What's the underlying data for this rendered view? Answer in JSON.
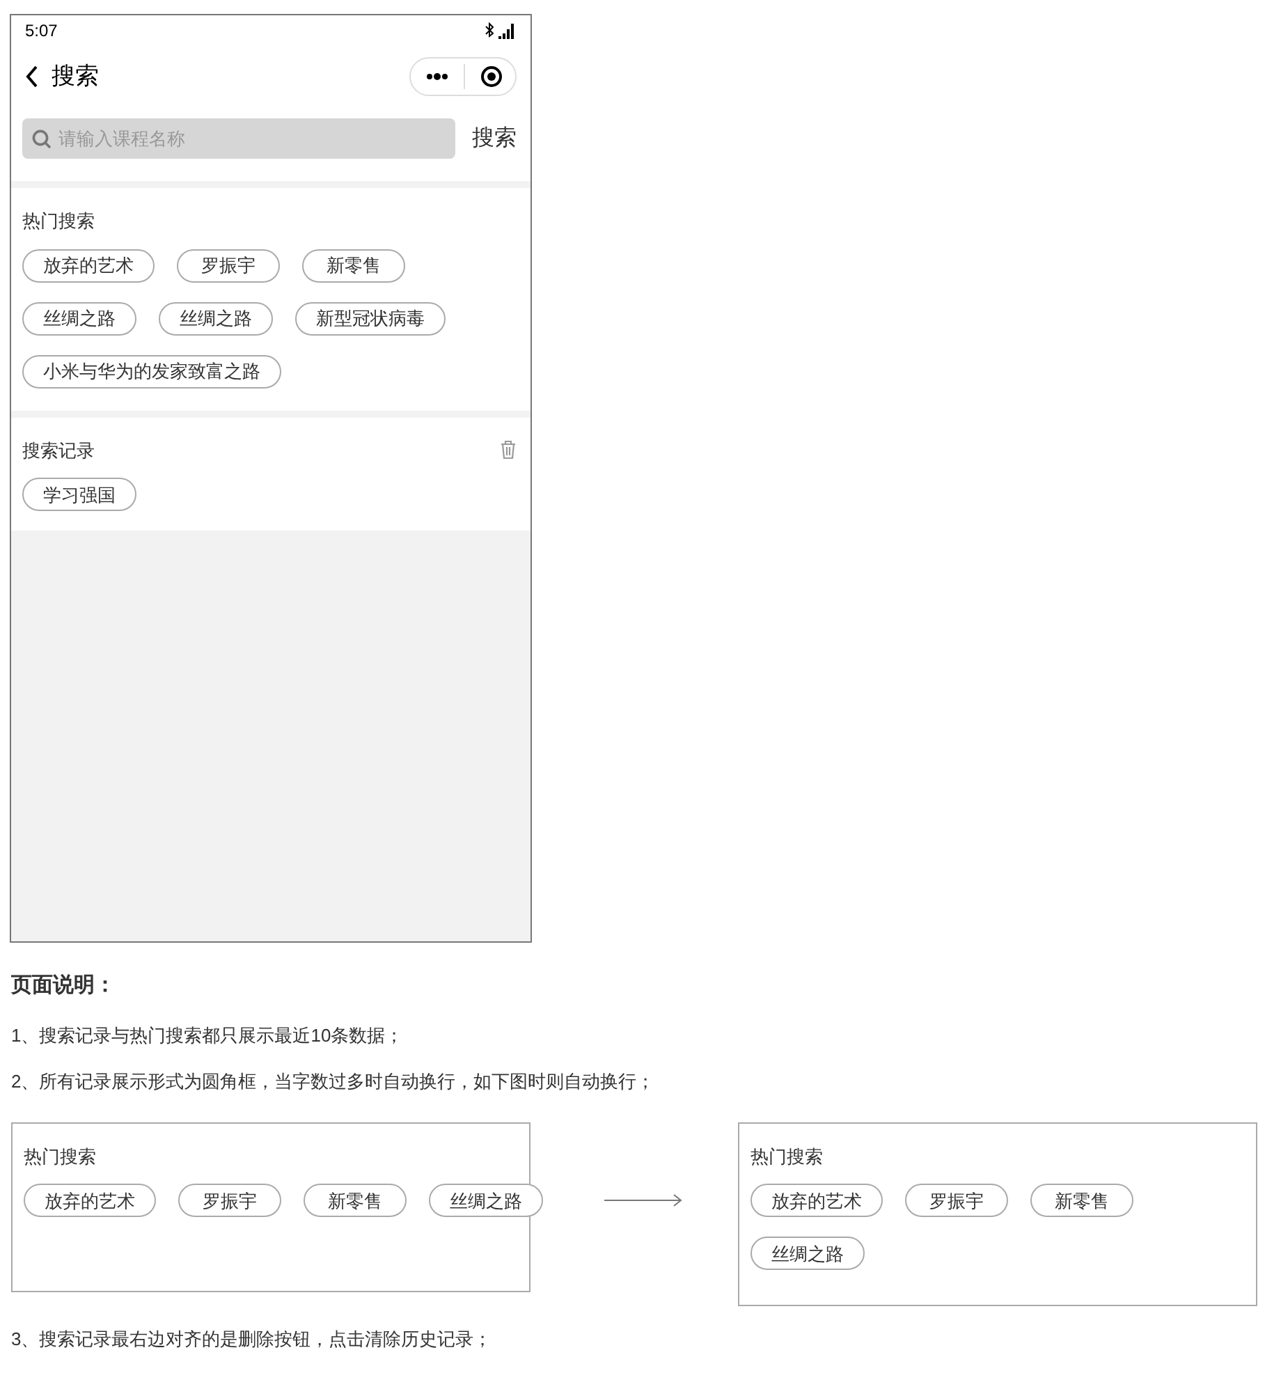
{
  "status_bar": {
    "time": "5:07"
  },
  "nav": {
    "title": "搜索"
  },
  "search": {
    "placeholder": "请输入课程名称",
    "button": "搜索"
  },
  "hot_search": {
    "title": "热门搜索",
    "tags": [
      "放弃的艺术",
      "罗振宇",
      "新零售",
      "丝绸之路",
      "丝绸之路",
      "新型冠状病毒",
      "小米与华为的发家致富之路"
    ]
  },
  "history": {
    "title": "搜索记录",
    "tags": [
      "学习强国"
    ]
  },
  "notes": {
    "heading": "页面说明：",
    "blocks": [
      {
        "kind": "text",
        "text": "1、搜索记录与热门搜索都只展示最近10条数据；"
      },
      {
        "kind": "text",
        "text": "2、所有记录展示形式为圆角框，当字数过多时自动换行，如下图时则自动换行；"
      },
      {
        "kind": "example",
        "before": {
          "title": "热门搜索",
          "tags": [
            "放弃的艺术",
            "罗振宇",
            "新零售",
            "丝绸之路"
          ]
        },
        "after": {
          "title": "热门搜索",
          "tags": [
            "放弃的艺术",
            "罗振宇",
            "新零售",
            "丝绸之路"
          ]
        }
      },
      {
        "kind": "text",
        "text": "3、搜索记录最右边对齐的是删除按钮，点击清除历史记录；"
      }
    ]
  }
}
